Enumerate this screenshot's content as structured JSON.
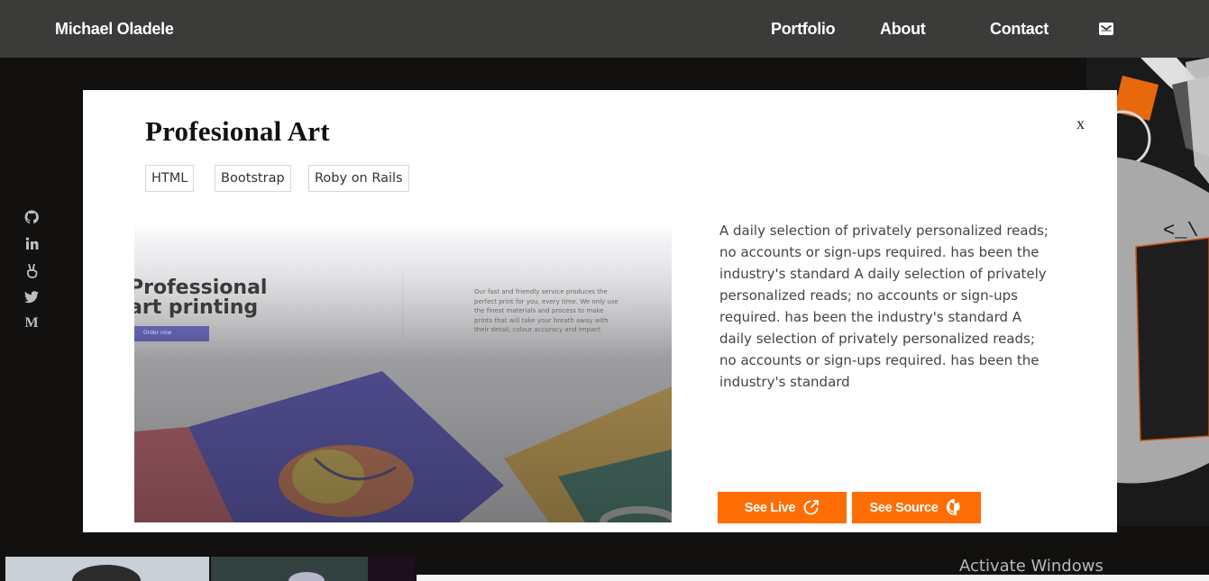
{
  "header": {
    "brand": "Michael Oladele",
    "nav": {
      "portfolio": "Portfolio",
      "about": "About",
      "contact": "Contact"
    },
    "mail_icon": "envelope-icon"
  },
  "social": {
    "items": [
      "github-icon",
      "linkedin-icon",
      "angellist-icon",
      "twitter-icon",
      "medium-icon"
    ],
    "medium_letter": "M"
  },
  "modal": {
    "title": "Profesional Art",
    "close": "x",
    "tags": [
      "HTML",
      "Bootstrap",
      "Roby on Rails"
    ],
    "preview": {
      "headline_1": "Professional",
      "headline_2": "art printing",
      "button": "Order now",
      "blurb_1": "Our fast and friendly service produces the",
      "blurb_2": "perfect print for you, every time. We only use",
      "blurb_3": "the finest materials and process to make",
      "blurb_4": "prints that will take your breath away with",
      "blurb_5": "their detail, colour accuracy and impact."
    },
    "description": "A daily selection of privately personalized reads; no accounts or sign-ups required. has been the industry's standard A daily selection of privately personalized reads; no accounts or sign-ups required. has been the industry's standard A daily selection of privately personalized reads; no accounts or sign-ups required. has been the industry's standard",
    "see_live": "See Live",
    "see_source": "See Source"
  },
  "watermark": "Activate Windows",
  "colors": {
    "accent": "#ff6d05",
    "navbar": "#3b3b3a",
    "background": "#121110"
  }
}
